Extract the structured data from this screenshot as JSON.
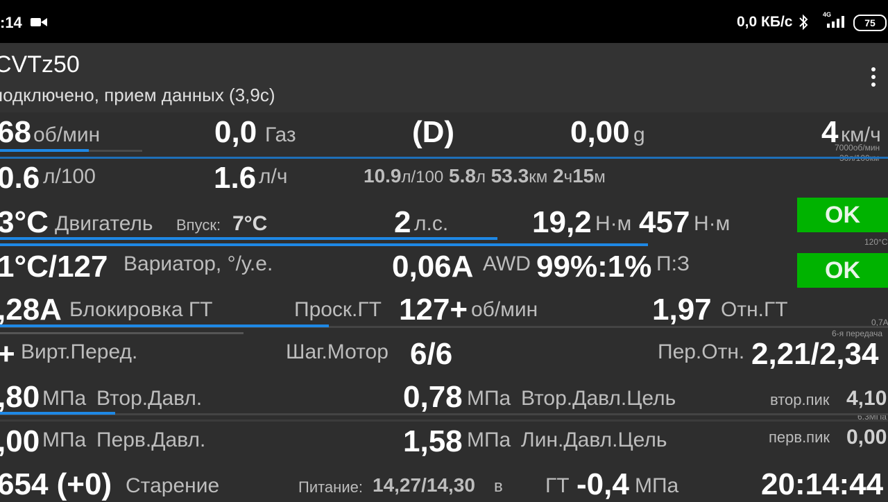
{
  "status_bar": {
    "time": ":14",
    "net_speed": "0,0 КБ/с",
    "signal_label": "4G",
    "battery": "75"
  },
  "app_bar": {
    "title": "CVTz50",
    "subtitle": "подключено, прием данных (3,9с)"
  },
  "rows": {
    "rpm": {
      "value": "68",
      "unit": "об/мин"
    },
    "throttle": {
      "value": "0,0",
      "label": "Газ"
    },
    "gear": "(D)",
    "gforce": {
      "value": "0,00",
      "unit": "g"
    },
    "speed": {
      "value": "4",
      "unit": "км/ч"
    },
    "scale_rpm": "7000об/мин",
    "scale_cons": "30л/100км",
    "cons": {
      "value": "0.6",
      "unit": "л/100"
    },
    "cons_h": {
      "value": "1.6",
      "unit": "л/ч"
    },
    "trip": {
      "avg": "10.9",
      "avg_unit": "л/100",
      "fuel": "5.8",
      "fuel_unit": "л",
      "dist": "53.3",
      "dist_unit": "км",
      "h": "2",
      "h_unit": "ч",
      "m": "15",
      "m_unit": "м"
    },
    "engine": {
      "value": "3°C",
      "label": "Двигатель",
      "intake_label": "Впуск:",
      "intake_value": "7°C",
      "hp": "2",
      "hp_unit": "л.с.",
      "torque": "19,2",
      "torque_unit": "Н·м",
      "torque_max": "457",
      "torque_max_unit": "Н·м",
      "status": "OK"
    },
    "scale_temp": "120°C",
    "cvt": {
      "value": "1°C/127",
      "label": "Вариатор, °/у.е.",
      "current": "0,06A",
      "awd_label": "AWD",
      "awd_value": "99%:1%",
      "mode": "П:З",
      "status": "OK"
    },
    "lockup": {
      "value": ",28A",
      "label": "Блокировка ГТ",
      "slip_label": "Проск.ГТ",
      "slip_value": "127+",
      "slip_unit": "об/мин",
      "ratio_value": "1,97",
      "ratio_label": "Отн.ГТ"
    },
    "scale_lock": "0,7A",
    "scale_gear": "6-я передача",
    "virtual_gear": {
      "value": "+",
      "label": "Вирт.Перед.",
      "stepper_label": "Шаг.Мотор",
      "stepper_value": "6/6",
      "ratio_label": "Пер.Отн.",
      "ratio_value": "2,21/2,34"
    },
    "secondary": {
      "value": ",80",
      "unit": "МПа",
      "label": "Втор.Давл.",
      "target": "0,78",
      "target_unit": "МПа",
      "target_label": "Втор.Давл.Цель",
      "peak_label": "втор.пик",
      "peak_value": "4,10"
    },
    "scale_press": "6,3МПа",
    "primary": {
      "value": ",00",
      "unit": "МПа",
      "label": "Перв.Давл.",
      "line": "1,58",
      "line_unit": "МПа",
      "line_label": "Лин.Давл.Цель",
      "peak_label": "перв.пик",
      "peak_value": "0,00"
    },
    "aging": {
      "value": "654 (+0)",
      "label": "Старение",
      "power_label": "Питание:",
      "power_value": "14,27/14,30",
      "power_unit": "в",
      "tc_label": "ГТ",
      "tc_value": "-0,4",
      "tc_unit": "МПа",
      "clock": "20:14:44"
    }
  },
  "bars": {
    "rpm": 0.1,
    "cons": 0.02,
    "engine_temp": 0.56,
    "cvt_temp": 0.73,
    "lockup": 0.37,
    "secondary": 0.13
  }
}
